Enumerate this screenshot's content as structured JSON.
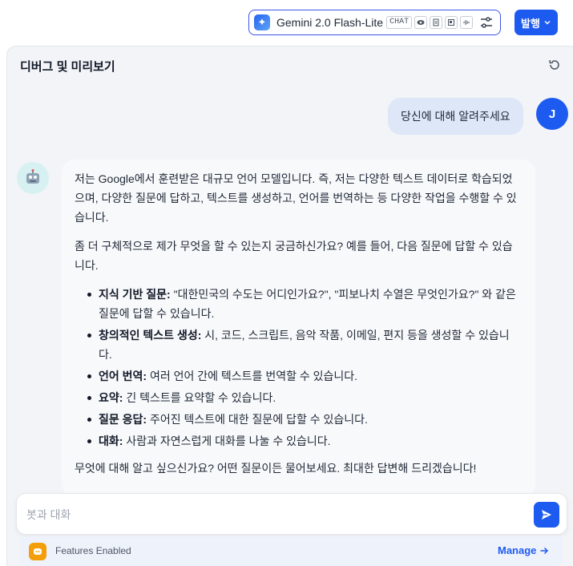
{
  "model": {
    "name": "Gemini 2.0 Flash-Lite",
    "tag": "CHAT",
    "capability_icons": [
      "eye-icon",
      "document-icon",
      "image-icon",
      "audio-icon"
    ]
  },
  "publish_label": "발행",
  "panel": {
    "title": "디버그 및 미리보기"
  },
  "user": {
    "avatar": "J",
    "message": "당신에 대해 알려주세요"
  },
  "bot": {
    "para1": "저는 Google에서 훈련받은 대규모 언어 모델입니다. 즉, 저는 다양한 텍스트 데이터로 학습되었으며, 다양한 질문에 답하고, 텍스트를 생성하고, 언어를 번역하는 등 다양한 작업을 수행할 수 있습니다.",
    "para2": "좀 더 구체적으로 제가 무엇을 할 수 있는지 궁금하신가요? 예를 들어, 다음 질문에 답할 수 있습니다.",
    "items": [
      {
        "title": "지식 기반 질문:",
        "text": " \"대한민국의 수도는 어디인가요?\", \"피보나치 수열은 무엇인가요?\" 와 같은 질문에 답할 수 있습니다."
      },
      {
        "title": "창의적인 텍스트 생성:",
        "text": " 시, 코드, 스크립트, 음악 작품, 이메일, 편지 등을 생성할 수 있습니다."
      },
      {
        "title": "언어 번역:",
        "text": " 여러 언어 간에 텍스트를 번역할 수 있습니다."
      },
      {
        "title": "요약:",
        "text": " 긴 텍스트를 요약할 수 있습니다."
      },
      {
        "title": "질문 응답:",
        "text": " 주어진 텍스트에 대한 질문에 답할 수 있습니다."
      },
      {
        "title": "대화:",
        "text": " 사람과 자연스럽게 대화를 나눌 수 있습니다."
      }
    ],
    "closing": "무엇에 대해 알고 싶으신가요? 어떤 질문이든 물어보세요. 최대한 답변해 드리겠습니다!"
  },
  "input": {
    "placeholder": "봇과 대화"
  },
  "features": {
    "label": "Features Enabled",
    "manage": "Manage"
  },
  "colors": {
    "accent": "#1d5bf0",
    "panel_bg": "#f2f4f7",
    "user_bubble": "#dde7f8"
  }
}
